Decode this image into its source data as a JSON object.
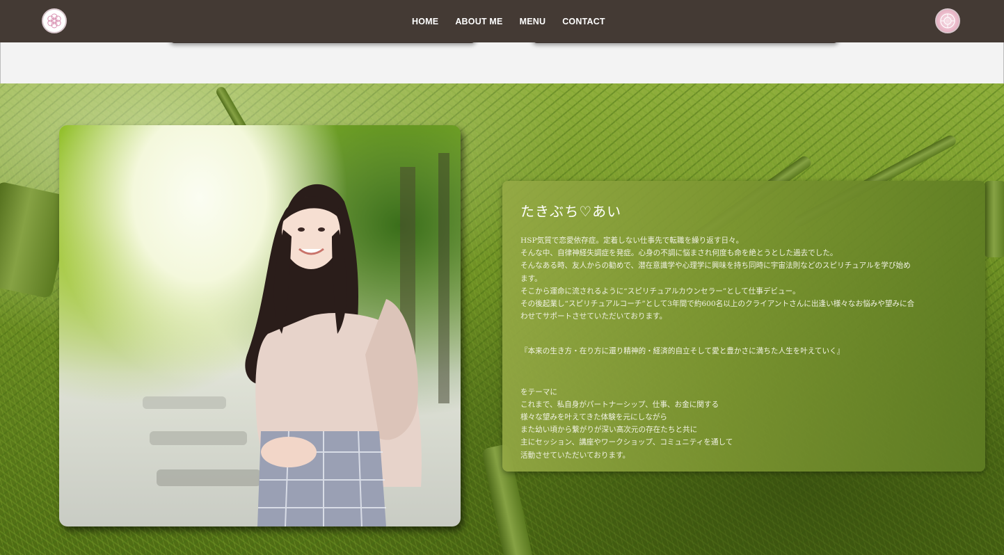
{
  "header": {
    "nav": [
      "HOME",
      "ABOUT ME",
      "MENU",
      "CONTACT"
    ],
    "logo_left_icon": "flower-logo-icon",
    "logo_right_icon": "pink-seal-logo-icon"
  },
  "profile": {
    "name": "たきぶち♡あい",
    "intro_lines": [
      "HSP気質で恋愛依存症。定着しない仕事先で転職を繰り返す日々。",
      "そんな中、自律神経失調症を発症。心身の不調に悩まされ何度も命を絶とうとした過去でした。",
      "そんなある時、友人からの勧めで、潜在意識学や心理学に興味を持ち同時に宇宙法則などのスピリチュアルを学び始め",
      "ます。",
      "そこから運命に流されるように“スピリチュアルカウンセラー”として仕事デビュー。",
      "その後起業し“スピリチュアルコーチ”として3年間で約600名以上のクライアントさんに出逢い様々なお悩みや望みに合",
      "わせてサポートさせていただいております。"
    ],
    "quote": "『本来の生き方・在り方に還り精神的・経済的自立そして愛と豊かさに満ちた人生を叶えていく』",
    "theme_lines": [
      "をテーマに",
      "これまで、私自身がパートナーシップ、仕事、お金に関する",
      "様々な望みを叶えてきた体験を元にしながら",
      "また幼い頃から繋がりが深い高次元の存在たちと共に",
      "主にセッション、講座やワークショップ、コミュニティを通して",
      "活動させていただいております。"
    ]
  },
  "colors": {
    "header_bg": "#443a34",
    "panel_bg": "#8aa23f",
    "bamboo_green": "#6f9024"
  }
}
